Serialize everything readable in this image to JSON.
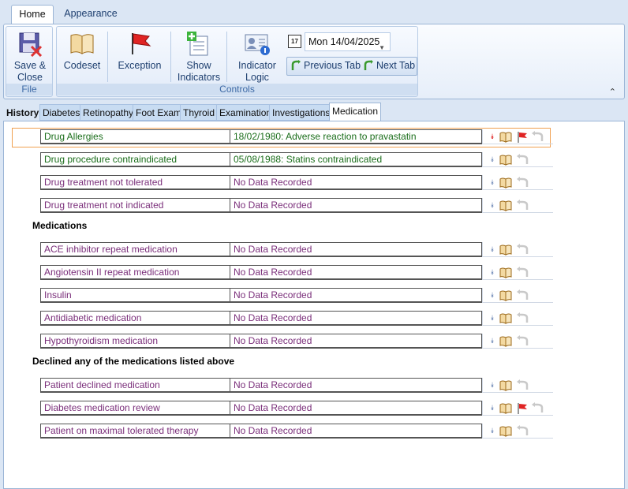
{
  "ribbon": {
    "tabs": [
      "Home",
      "Appearance"
    ],
    "file_group": {
      "label": "File",
      "save_close": [
        "Save &",
        "Close"
      ]
    },
    "controls_group": {
      "label": "Controls",
      "codeset": "Codeset",
      "exception": "Exception",
      "show_indicators": [
        "Show",
        "Indicators"
      ],
      "indicator_logic": [
        "Indicator",
        "Logic"
      ],
      "date": "Mon 14/04/2025",
      "calendar_glyph": "17",
      "previous_tab": "Previous Tab",
      "next_tab": "Next Tab"
    }
  },
  "section_tabs": [
    "History",
    "Diabetes",
    "Retinopathy",
    "Foot Exam",
    "Thyroid",
    "Examination",
    "Investigations",
    "Medication"
  ],
  "active_section_tab": "Medication",
  "headings": {
    "medications": "Medications",
    "declined": "Declined any of the medications listed above"
  },
  "rows": [
    {
      "label": "Drug Allergies",
      "value": "18/02/1980: Adverse reaction to pravastatin"
    },
    {
      "label": "Drug procedure contraindicated",
      "value": "05/08/1988: Statins contraindicated"
    },
    {
      "label": "Drug treatment not tolerated",
      "value": "No Data Recorded"
    },
    {
      "label": "Drug treatment not indicated",
      "value": "No Data Recorded"
    },
    {
      "label": "ACE inhibitor repeat medication",
      "value": "No Data Recorded"
    },
    {
      "label": "Angiotensin II repeat medication",
      "value": "No Data Recorded"
    },
    {
      "label": "Insulin",
      "value": "No Data Recorded"
    },
    {
      "label": "Antidiabetic medication",
      "value": "No Data Recorded"
    },
    {
      "label": "Hypothyroidism medication",
      "value": "No Data Recorded"
    },
    {
      "label": "Patient declined medication",
      "value": "No Data Recorded"
    },
    {
      "label": "Diabetes medication review",
      "value": "No Data Recorded"
    },
    {
      "label": "Patient on maximal tolerated therapy",
      "value": "No Data Recorded"
    }
  ],
  "icons": {
    "chevron": "chevron-down-icon",
    "book": "codeset-book-icon",
    "flag": "exception-flag-icon",
    "undo": "undo-arrow-icon",
    "collapse": "collapse-ribbon-icon"
  },
  "colors": {
    "recorded_text": "#1a6d1a",
    "unrecorded_text": "#7a2e7a",
    "selected_row_border": "#f0a050",
    "alert_chevron": "#dd1111",
    "flag": "#dd1111"
  }
}
